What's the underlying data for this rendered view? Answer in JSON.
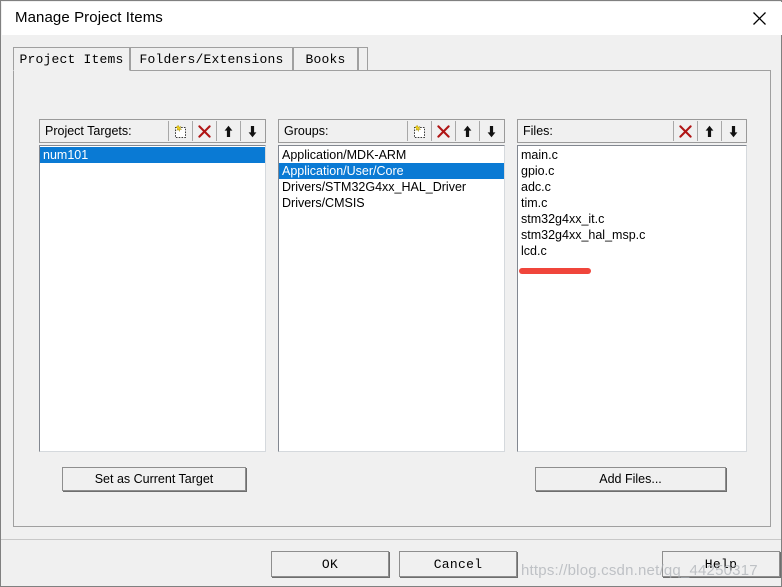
{
  "window": {
    "title": "Manage Project Items",
    "close_icon": "close-icon"
  },
  "tabs": [
    {
      "label": "Project Items",
      "active": true
    },
    {
      "label": "Folders/Extensions",
      "active": false
    },
    {
      "label": "Books",
      "active": false
    }
  ],
  "columns": {
    "targets": {
      "header": "Project Targets:",
      "icons": [
        "new-item-icon",
        "delete-icon",
        "move-up-icon",
        "move-down-icon"
      ],
      "items": [
        {
          "label": "num101",
          "selected": true
        }
      ]
    },
    "groups": {
      "header": "Groups:",
      "icons": [
        "new-item-icon",
        "delete-icon",
        "move-up-icon",
        "move-down-icon"
      ],
      "items": [
        {
          "label": "Application/MDK-ARM",
          "selected": false
        },
        {
          "label": "Application/User/Core",
          "selected": true
        },
        {
          "label": "Drivers/STM32G4xx_HAL_Driver",
          "selected": false
        },
        {
          "label": "Drivers/CMSIS",
          "selected": false
        }
      ]
    },
    "files": {
      "header": "Files:",
      "icons": [
        "delete-icon",
        "move-up-icon",
        "move-down-icon"
      ],
      "items": [
        {
          "label": "main.c",
          "selected": false
        },
        {
          "label": "gpio.c",
          "selected": false
        },
        {
          "label": "adc.c",
          "selected": false
        },
        {
          "label": "tim.c",
          "selected": false
        },
        {
          "label": "stm32g4xx_it.c",
          "selected": false
        },
        {
          "label": "stm32g4xx_hal_msp.c",
          "selected": false
        },
        {
          "label": "lcd.c",
          "selected": false
        }
      ]
    }
  },
  "buttons": {
    "set_as_current_target": "Set as Current Target",
    "add_files": "Add Files...",
    "ok": "OK",
    "cancel": "Cancel",
    "help": "Help"
  },
  "annotation": {
    "type": "red-underline",
    "target": "lcd.c",
    "color": "#f0453b"
  },
  "watermark": {
    "text": "https://blog.csdn.net/qq_44250317"
  },
  "colors": {
    "selection_blue": "#0a7ad4",
    "dialog_face": "#f0f0f0",
    "list_background": "#ffffff",
    "delete_red": "#b01515",
    "annotation_red": "#f0453b"
  }
}
